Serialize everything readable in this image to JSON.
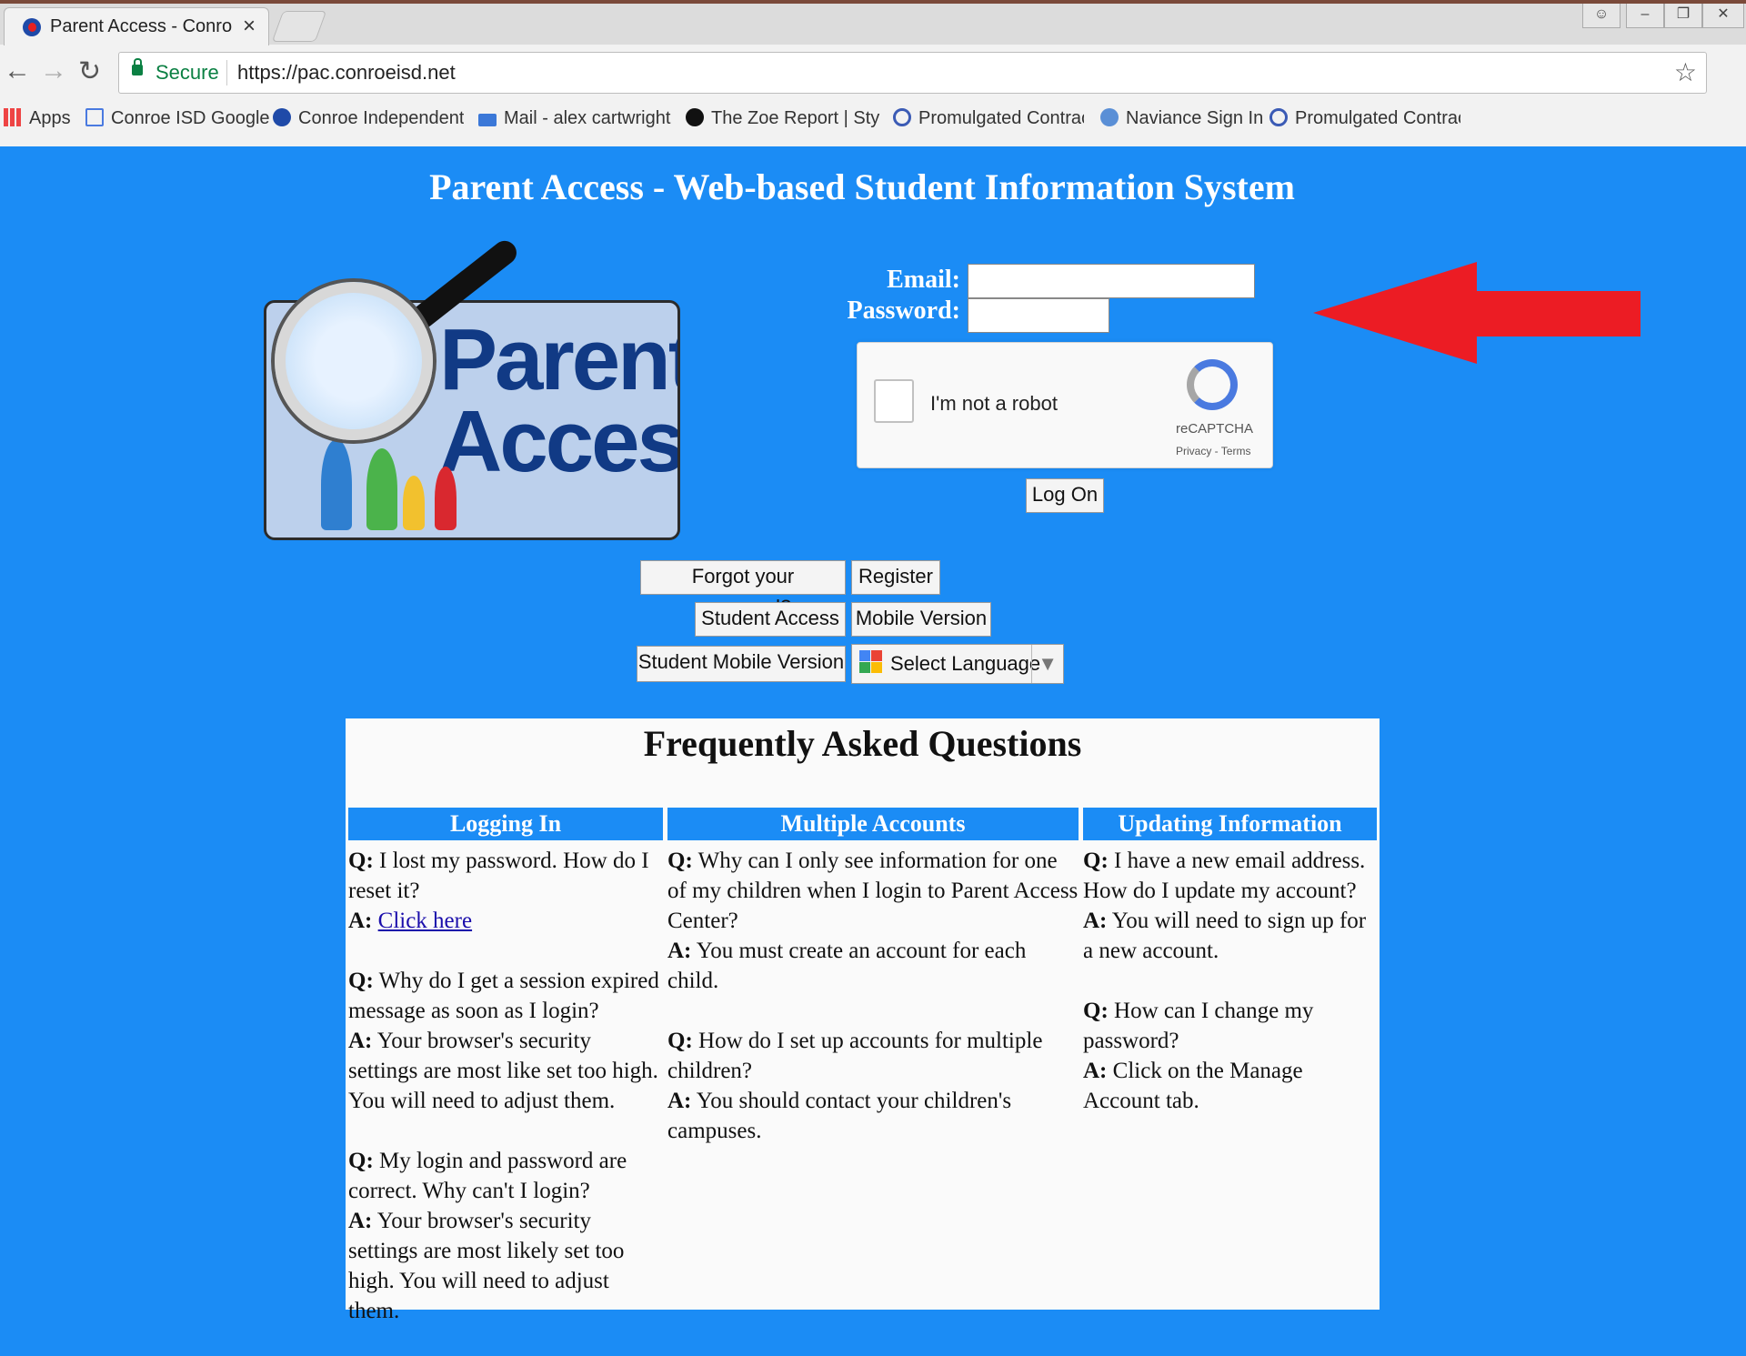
{
  "browser": {
    "tab_title": "Parent Access - Conroe I",
    "tab_close": "×",
    "secure_label": "Secure",
    "url": "https://pac.conroeisd.net",
    "bookmarks": [
      {
        "label": "Apps"
      },
      {
        "label": "Conroe ISD Google"
      },
      {
        "label": "Conroe Independent"
      },
      {
        "label": "Mail - alex cartwright"
      },
      {
        "label": "The Zoe Report | Style"
      },
      {
        "label": "Promulgated Contrac"
      },
      {
        "label": "Naviance Sign In"
      },
      {
        "label": "Promulgated Contrac"
      }
    ]
  },
  "page": {
    "title": "Parent Access - Web-based Student Information System",
    "logo": {
      "line1": "Parent",
      "line2": "Access"
    }
  },
  "login": {
    "email_label": "Email:",
    "password_label": "Password:",
    "email_value": "",
    "password_value": "",
    "captcha_text": "I'm not a robot",
    "captcha_brand": "reCAPTCHA",
    "captcha_links": "Privacy - Terms",
    "logon_label": "Log On"
  },
  "buttons": {
    "forgot": "Forgot your password?",
    "register": "Register",
    "student_access": "Student Access",
    "mobile_version": "Mobile Version",
    "student_mobile": "Student Mobile Version",
    "select_language": "Select Language",
    "select_arrow": "▼"
  },
  "faq": {
    "title": "Frequently Asked Questions",
    "columns": [
      {
        "heading": "Logging In",
        "items": [
          {
            "q": "I lost my password. How do I reset it?",
            "a": "Click here",
            "a_is_link": true
          },
          {
            "q": "Why do I get a session expired message as soon as I login?",
            "a": "Your browser's security settings are most like set too high. You will need to adjust them."
          },
          {
            "q": "My login and password are correct. Why can't I login?",
            "a": "Your browser's security settings are most likely set too high. You will need to adjust them."
          }
        ]
      },
      {
        "heading": "Multiple Accounts",
        "items": [
          {
            "q": "Why can I only see information for one of my children when I login to Parent Access Center?",
            "a": "You must create an account for each child."
          },
          {
            "q": "How do I set up accounts for multiple children?",
            "a": "You should contact your children's campuses."
          }
        ]
      },
      {
        "heading": "Updating Information",
        "items": [
          {
            "q": "I have a new email address. How do I update my account?",
            "a": "You will need to sign up for a new account."
          },
          {
            "q": "How can I change my password?",
            "a": "Click on the Manage Account tab."
          }
        ]
      }
    ],
    "q_prefix": "Q:",
    "a_prefix": "A:"
  },
  "colors": {
    "page_bg": "#1b8cf5",
    "arrow": "#ec1c24",
    "link": "#1a0dab"
  }
}
